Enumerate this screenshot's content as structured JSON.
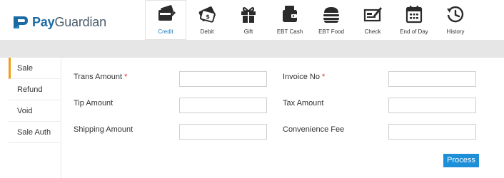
{
  "brand": {
    "name_part1": "Pay",
    "name_part2": "Guardian"
  },
  "tabs": [
    {
      "label": "Credit",
      "icon": "credit-card-icon",
      "active": true
    },
    {
      "label": "Debit",
      "icon": "debit-card-icon",
      "active": false
    },
    {
      "label": "Gift",
      "icon": "gift-icon",
      "active": false
    },
    {
      "label": "EBT Cash",
      "icon": "ebt-cash-icon",
      "active": false
    },
    {
      "label": "EBT Food",
      "icon": "ebt-food-icon",
      "active": false
    },
    {
      "label": "Check",
      "icon": "check-icon",
      "active": false
    },
    {
      "label": "End of Day",
      "icon": "calendar-icon",
      "active": false
    },
    {
      "label": "History",
      "icon": "history-icon",
      "active": false
    }
  ],
  "sidebar": {
    "items": [
      {
        "label": "Sale",
        "active": true
      },
      {
        "label": "Refund",
        "active": false
      },
      {
        "label": "Void",
        "active": false
      },
      {
        "label": "Sale Auth",
        "active": false
      }
    ]
  },
  "form": {
    "trans_amount": {
      "label": "Trans Amount",
      "required_mark": "*",
      "value": ""
    },
    "tip_amount": {
      "label": "Tip Amount",
      "value": ""
    },
    "shipping_amount": {
      "label": "Shipping Amount",
      "value": ""
    },
    "invoice_no": {
      "label": "Invoice No",
      "required_mark": "*",
      "value": ""
    },
    "tax_amount": {
      "label": "Tax Amount",
      "value": ""
    },
    "convenience_fee": {
      "label": "Convenience Fee",
      "value": ""
    }
  },
  "actions": {
    "process_label": "Process"
  },
  "colors": {
    "accent": "#1d8fd8",
    "brand_blue": "#1a6aa3",
    "active_indicator": "#f39c12",
    "required": "#d9322f",
    "strip": "#e6e6e6",
    "icon_dark": "#2b2b2b"
  }
}
